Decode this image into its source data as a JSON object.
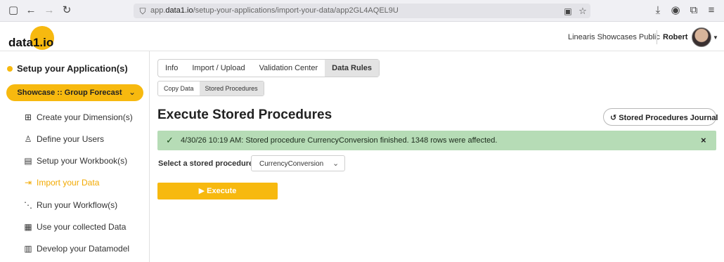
{
  "browser": {
    "url_prefix": "app.",
    "url_domain": "data1.io",
    "url_path": "/setup-your-applications/import-your-data/app2GL4AQEL9U"
  },
  "header": {
    "logo_text": "data1.io",
    "org_name": "Linearis Showcases Public",
    "user_name": "Robert"
  },
  "sidebar": {
    "section_title": "Setup your Application(s)",
    "project_selector": "Showcase :: Group Forecast",
    "items": [
      {
        "label": "Create your Dimension(s)",
        "icon": "hierarchy-icon"
      },
      {
        "label": "Define your Users",
        "icon": "user-icon"
      },
      {
        "label": "Setup your Workbook(s)",
        "icon": "document-icon"
      },
      {
        "label": "Import your Data",
        "icon": "import-icon",
        "active": true
      },
      {
        "label": "Run your Workflow(s)",
        "icon": "workflow-icon"
      },
      {
        "label": "Use your collected Data",
        "icon": "table-icon"
      },
      {
        "label": "Develop your Datamodel",
        "icon": "datamodel-icon"
      }
    ]
  },
  "tabs": [
    "Info",
    "Import / Upload",
    "Validation Center",
    "Data Rules"
  ],
  "active_tab": "Data Rules",
  "subtabs": [
    "Copy Data",
    "Stored Procedures"
  ],
  "active_subtab": "Stored Procedures",
  "page_title": "Execute Stored Procedures",
  "journal_button": "Stored Procedures Journal",
  "alert": {
    "message": "4/30/26 10:19 AM: Stored procedure CurrencyConversion finished. 1348 rows were affected.",
    "close": "×"
  },
  "select": {
    "label": "Select a stored procedure",
    "value": "CurrencyConversion"
  },
  "execute_button": "Execute",
  "colors": {
    "accent": "#f7b90f",
    "success_bg": "#b6dcb6",
    "active_nav": "#f2a900"
  }
}
